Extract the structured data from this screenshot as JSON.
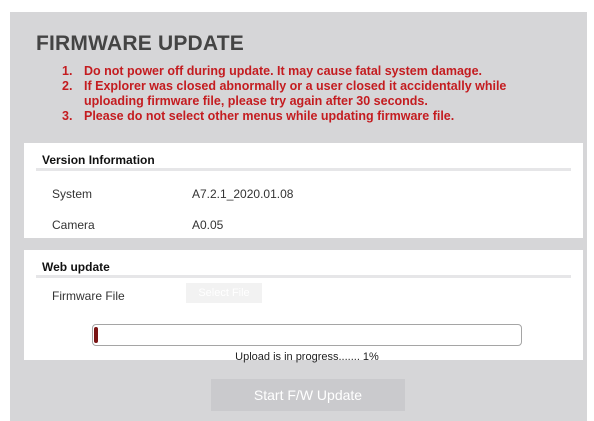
{
  "page": {
    "title": "FIRMWARE UPDATE",
    "warnings": [
      {
        "num": "1.",
        "text": "Do not power off during update. It may cause fatal system damage."
      },
      {
        "num": "2.",
        "text": "If Explorer was closed abnormally or a user closed it accidentally while uploading firmware file, please try again after 30 seconds."
      },
      {
        "num": "3.",
        "text": "Please do not select other menus while updating firmware file."
      }
    ]
  },
  "version_info": {
    "header": "Version Information",
    "rows": [
      {
        "label": "System",
        "value": "A7.2.1_2020.01.08"
      },
      {
        "label": "Camera",
        "value": "A0.05"
      }
    ]
  },
  "web_update": {
    "header": "Web update",
    "firmware_label": "Firmware File",
    "select_button": "Select File",
    "progress_fraction": 0.01,
    "progress_text": "Upload is in progress....... 1%",
    "start_button": "Start F/W Update"
  },
  "colors": {
    "background": "#d6d6d8",
    "warning": "#c41c20",
    "progress": "#7a1414",
    "button_disabled": "#cacacd"
  }
}
